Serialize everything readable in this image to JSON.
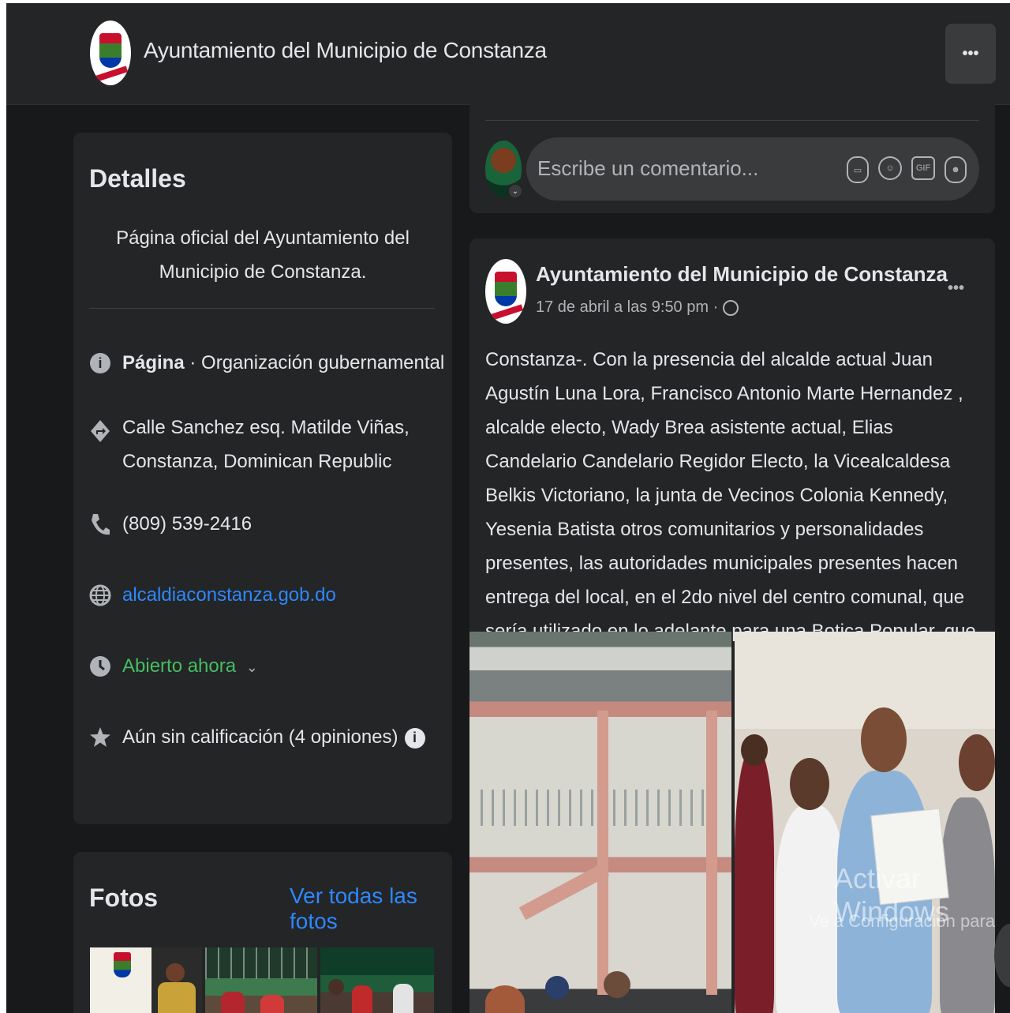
{
  "header": {
    "page_name": "Ayuntamiento del Municipio de Constanza",
    "more_label": "•••"
  },
  "details": {
    "title": "Detalles",
    "about": "Página oficial del Ayuntamiento del Municipio de Constanza.",
    "category_label": "Página",
    "category_value": " · Organización gubernamental",
    "address": "Calle Sanchez esq. Matilde Viñas, Constanza, Dominican Republic",
    "phone": "(809) 539-2416",
    "website": "alcaldiaconstanza.gob.do",
    "hours": "Abierto ahora",
    "rating": "Aún sin calificación (4 opiniones)"
  },
  "photos": {
    "title": "Fotos",
    "see_all": "Ver todas las fotos"
  },
  "comment": {
    "placeholder": "Escribe un comentario...",
    "icons": [
      "sticker-icon",
      "emoji-icon",
      "gif-icon",
      "avatar-sticker-icon"
    ]
  },
  "post": {
    "author": "Ayuntamiento del Municipio de Constanza",
    "timestamp": "17 de abril a las 9:50 pm · ",
    "privacy_icon": "globe-icon",
    "menu": "•••",
    "text": "Constanza-. Con la presencia del alcalde actual Juan Agustín Luna Lora,  Francisco Antonio Marte Hernandez , alcalde electo, Wady Brea asistente actual, Elias Candelario Candelario Regidor Electo, la Vicealcaldesa Belkis Victoriano, la junta de Vecinos Colonia Kennedy, Yesenia Batista otros comunitarios y personalidades presentes, las autoridades municipales presentes hacen entrega del local, en el 2do nivel del centro comunal, que sería utilizado en lo adelante para una Botica Popular, que demanda la comunidad."
  },
  "watermark": {
    "line1": "Activar Windows",
    "line2": "Ve a Configuración para activar Windows."
  },
  "colors": {
    "background": "#18191a",
    "card": "#242526",
    "link": "#2d88ff",
    "open": "#45bd62",
    "text": "#e4e6eb",
    "secondary": "#b0b3b8"
  }
}
